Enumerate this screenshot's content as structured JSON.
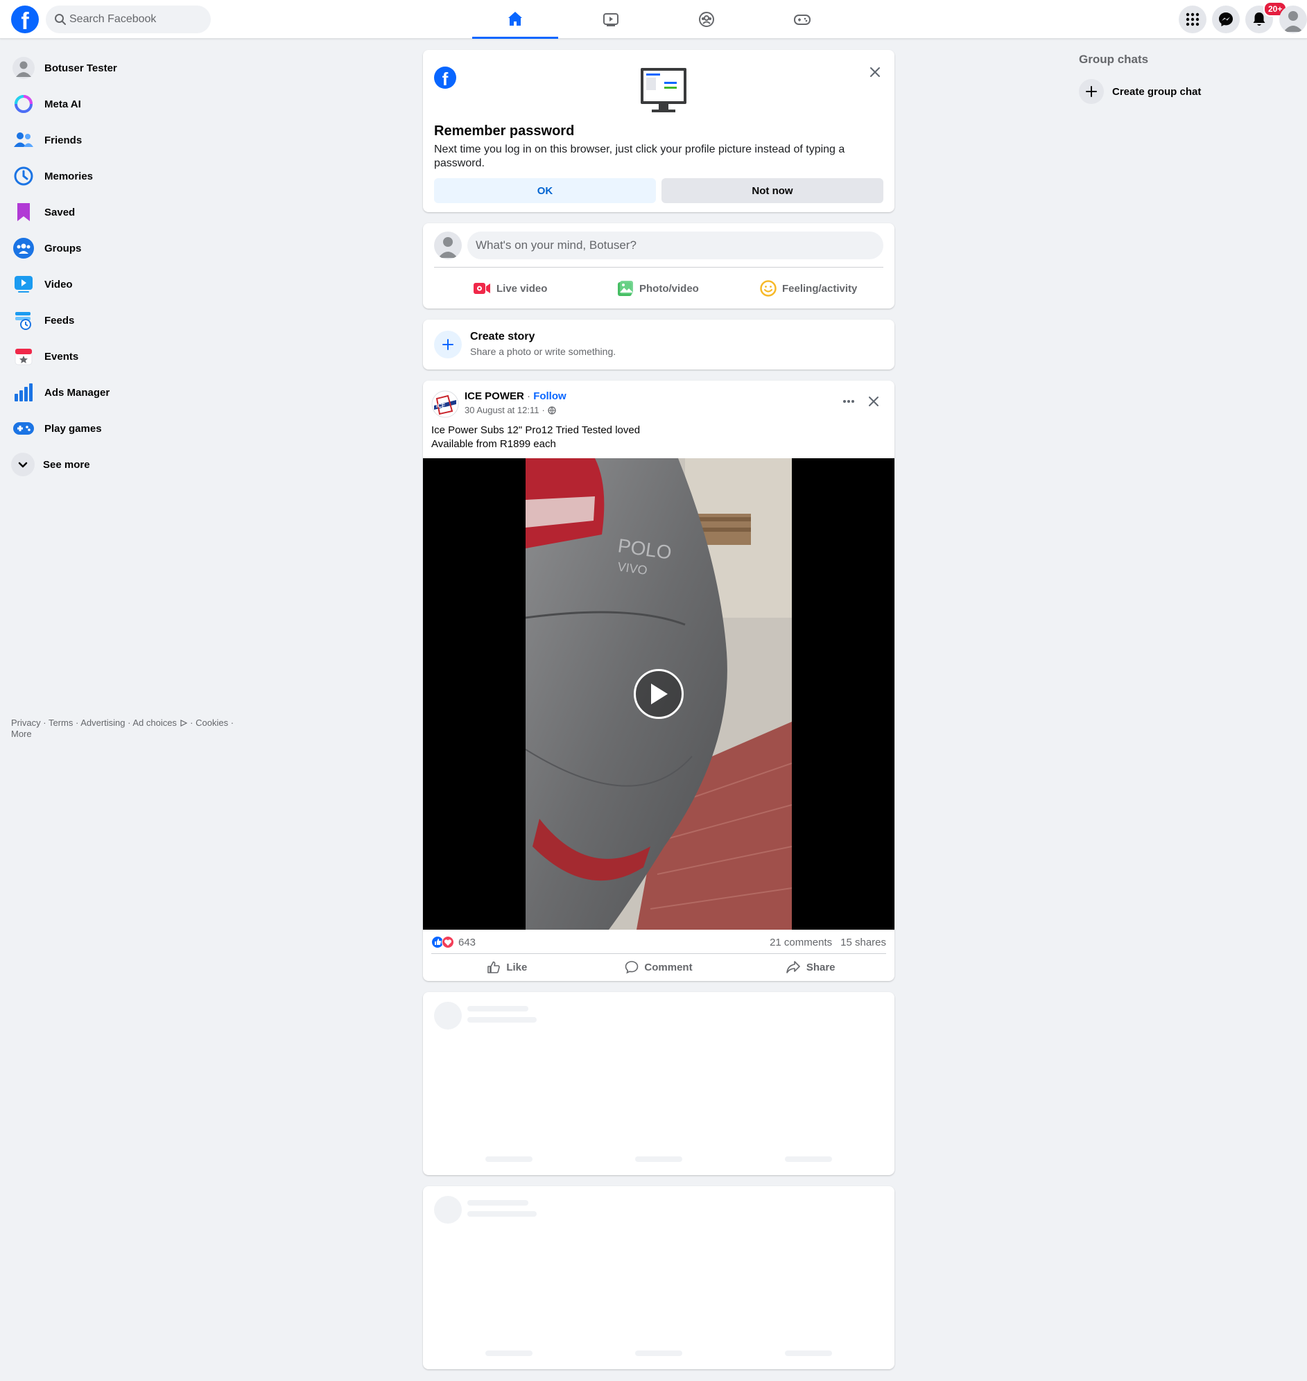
{
  "header": {
    "logo": "f",
    "search_placeholder": "Search Facebook",
    "notifications_badge": "20+",
    "nav_tabs": [
      {
        "name": "home",
        "active": true
      },
      {
        "name": "video",
        "active": false
      },
      {
        "name": "groups",
        "active": false
      },
      {
        "name": "gaming",
        "active": false
      }
    ]
  },
  "sidebar": {
    "items": [
      {
        "label": "Botuser Tester",
        "icon": "profile-avatar"
      },
      {
        "label": "Meta AI",
        "icon": "meta-ai-icon"
      },
      {
        "label": "Friends",
        "icon": "friends-icon"
      },
      {
        "label": "Memories",
        "icon": "memories-icon"
      },
      {
        "label": "Saved",
        "icon": "saved-icon"
      },
      {
        "label": "Groups",
        "icon": "groups-icon"
      },
      {
        "label": "Video",
        "icon": "video-icon"
      },
      {
        "label": "Feeds",
        "icon": "feeds-icon"
      },
      {
        "label": "Events",
        "icon": "events-icon"
      },
      {
        "label": "Ads Manager",
        "icon": "ads-manager-icon"
      },
      {
        "label": "Play games",
        "icon": "play-games-icon"
      },
      {
        "label": "See more",
        "icon": "chevron-down-icon"
      }
    ],
    "footer": {
      "privacy": "Privacy",
      "terms": "Terms",
      "advertising": "Advertising",
      "ad_choices": "Ad choices",
      "cookies": "Cookies",
      "more": "More"
    }
  },
  "remember_password": {
    "title": "Remember password",
    "body": "Next time you log in on this browser, just click your profile picture instead of typing a password.",
    "ok_label": "OK",
    "not_now_label": "Not now"
  },
  "composer": {
    "placeholder": "What's on your mind, Botuser?",
    "live_video": "Live video",
    "photo_video": "Photo/video",
    "feeling": "Feeling/activity"
  },
  "create_story": {
    "title": "Create story",
    "subtitle": "Share a photo or write something."
  },
  "post": {
    "author": "ICE POWER",
    "follow": "Follow",
    "separator": "·",
    "timestamp": "30 August at 12:11",
    "text_line1": "Ice Power Subs 12\"  Pro12 Tried Tested loved",
    "text_line2": "Available from R1899 each",
    "video_caption_brand": "POLO",
    "video_caption_model": "VIVO",
    "reactions_count": "643",
    "comments": "21 comments",
    "shares": "15 shares",
    "like_label": "Like",
    "comment_label": "Comment",
    "share_label": "Share"
  },
  "right_column": {
    "heading": "Group chats",
    "create_label": "Create group chat"
  },
  "colors": {
    "brand_blue": "#0866ff",
    "background": "#f0f2f5",
    "secondary_text": "#65676b",
    "badge_red": "#e41e3f"
  }
}
